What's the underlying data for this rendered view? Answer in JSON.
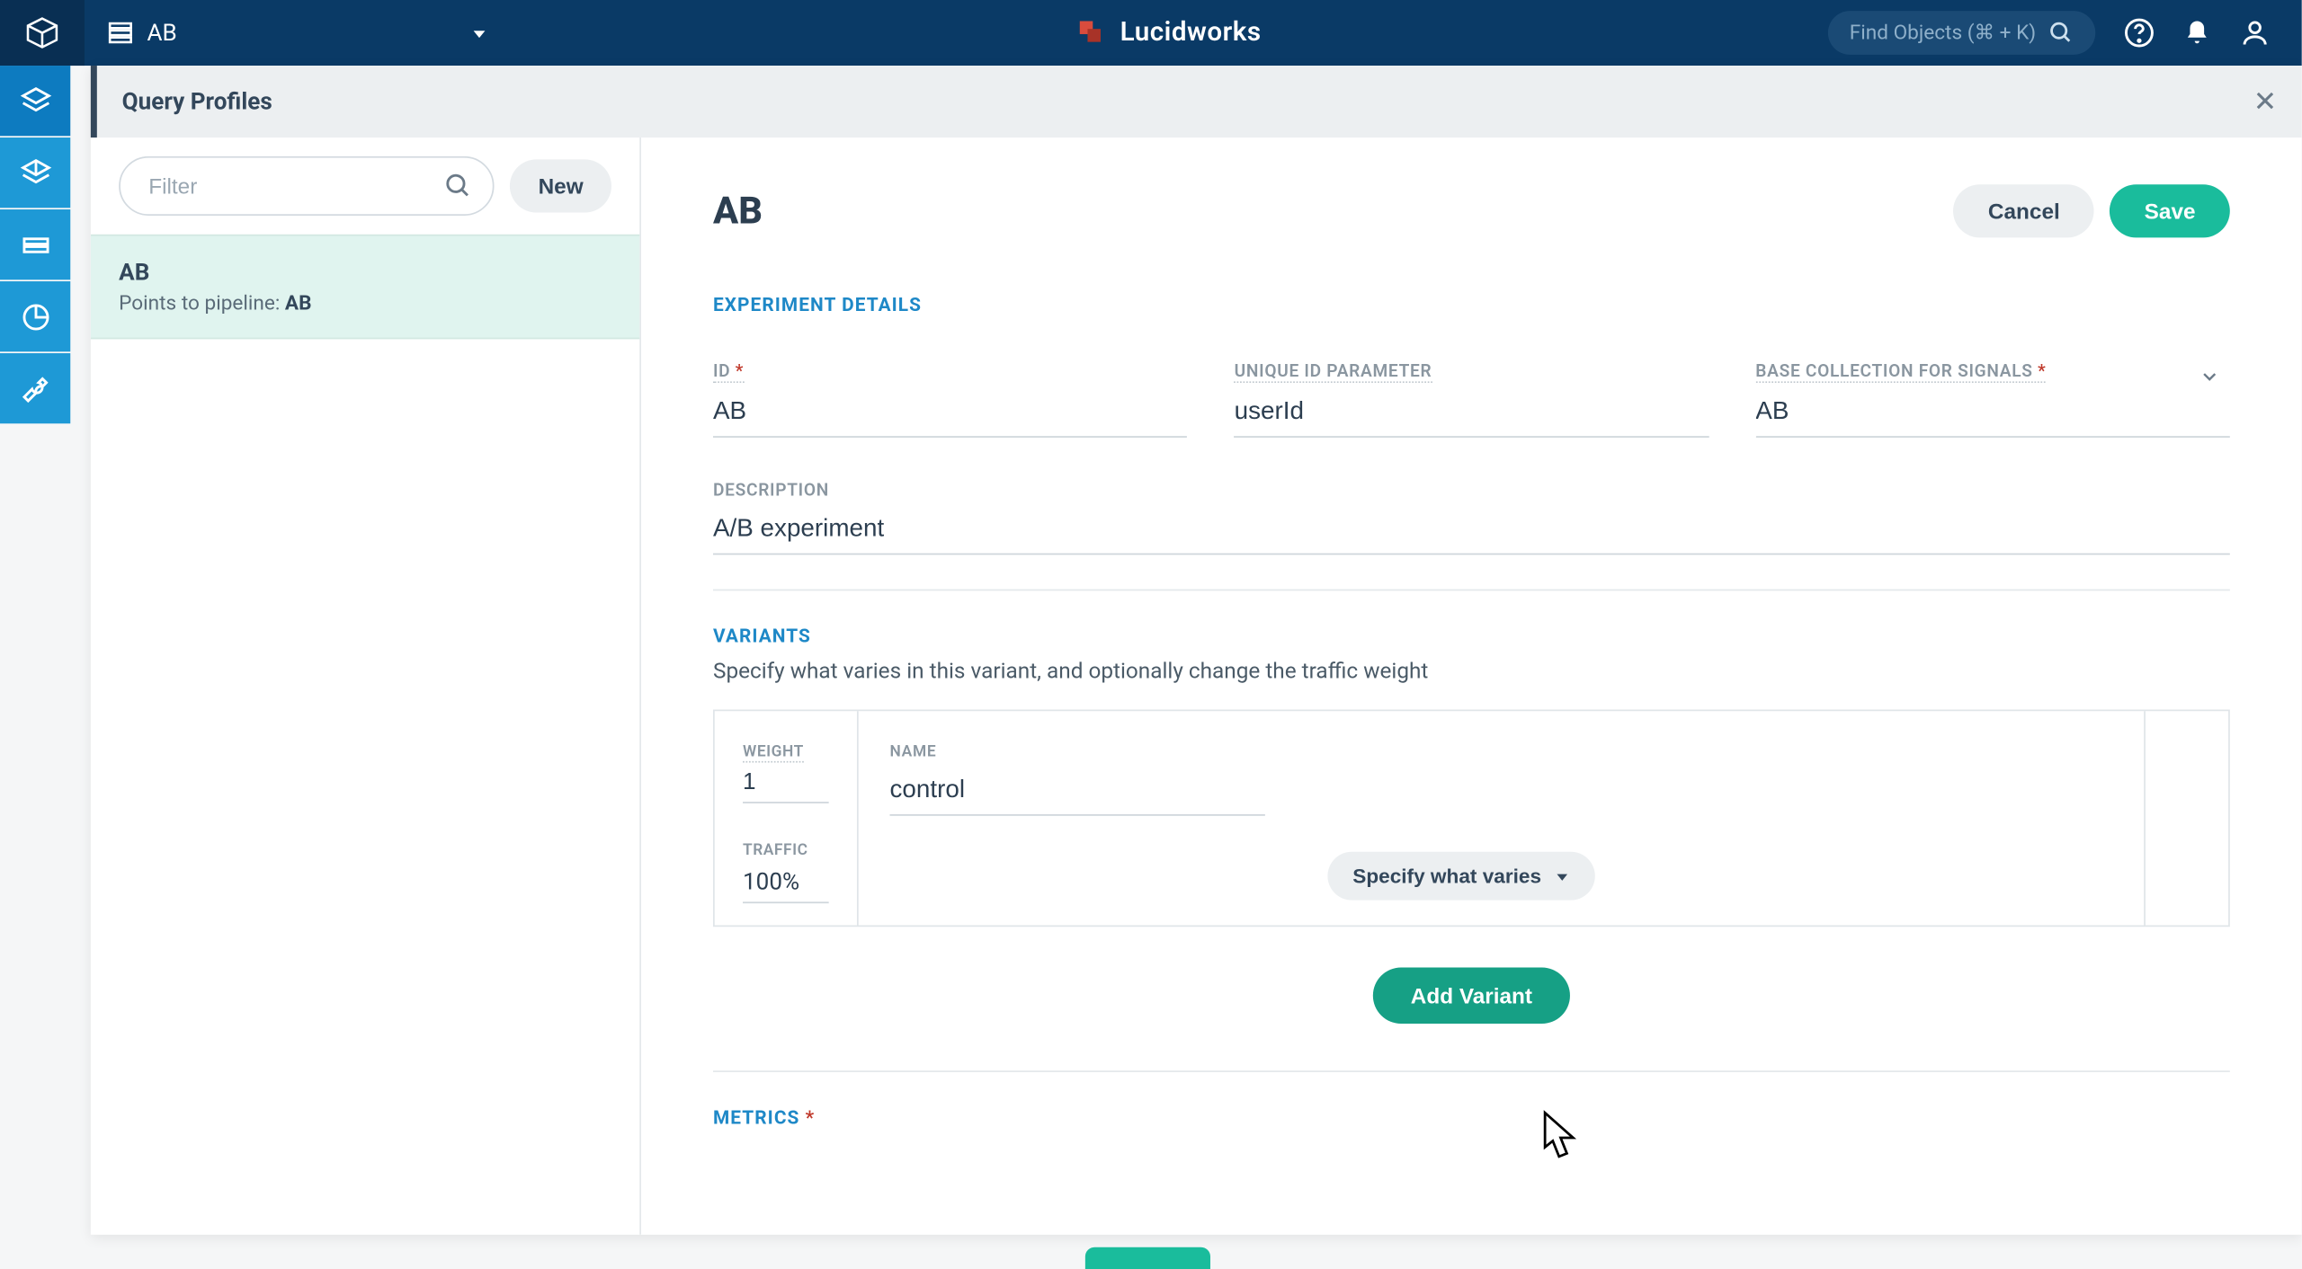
{
  "topbar": {
    "app_name": "AB",
    "brand": "Lucidworks",
    "find_placeholder": "Find Objects (⌘ + K)"
  },
  "panel": {
    "title": "Query Profiles"
  },
  "sidebar": {
    "filter_placeholder": "Filter",
    "new_label": "New",
    "item_name": "AB",
    "item_subtext_prefix": "Points to pipeline: ",
    "item_subtext_value": "AB"
  },
  "main": {
    "title": "AB",
    "cancel": "Cancel",
    "save": "Save",
    "section_experiment": "EXPERIMENT DETAILS",
    "fields": {
      "id_label": "ID",
      "id_value": "AB",
      "uid_label": "UNIQUE ID PARAMETER",
      "uid_value": "userId",
      "base_label": "BASE COLLECTION FOR SIGNALS",
      "base_value": "AB",
      "desc_label": "DESCRIPTION",
      "desc_value": "A/B experiment"
    },
    "section_variants": "VARIANTS",
    "variants_hint": "Specify what varies in this variant, and optionally change the traffic weight",
    "variant": {
      "weight_label": "WEIGHT",
      "weight_value": "1",
      "traffic_label": "TRAFFIC",
      "traffic_value": "100%",
      "name_label": "NAME",
      "name_value": "control",
      "specify_label": "Specify what varies"
    },
    "add_variant": "Add Variant",
    "section_metrics": "METRICS"
  }
}
